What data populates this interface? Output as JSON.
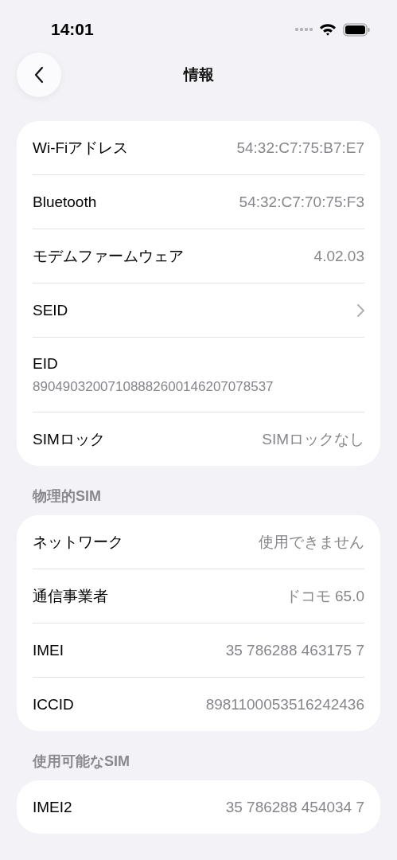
{
  "status_bar": {
    "time": "14:01"
  },
  "nav": {
    "title": "情報"
  },
  "sections": [
    {
      "rows": [
        {
          "kind": "value",
          "label": "Wi-Fiアドレス",
          "value": "54:32:C7:75:B7:E7"
        },
        {
          "kind": "value",
          "label": "Bluetooth",
          "value": "54:32:C7:70:75:F3"
        },
        {
          "kind": "value",
          "label": "モデムファームウェア",
          "value": "4.02.03"
        },
        {
          "kind": "chevron",
          "label": "SEID"
        },
        {
          "kind": "stacked",
          "label": "EID",
          "value": "89049032007108882600146207078537"
        },
        {
          "kind": "value",
          "label": "SIMロック",
          "value": "SIMロックなし"
        }
      ]
    },
    {
      "header": "物理的SIM",
      "rows": [
        {
          "kind": "value",
          "label": "ネットワーク",
          "value": "使用できません"
        },
        {
          "kind": "value",
          "label": "通信事業者",
          "value": "ドコモ 65.0"
        },
        {
          "kind": "value",
          "label": "IMEI",
          "value": "35 786288 463175 7"
        },
        {
          "kind": "value",
          "label": "ICCID",
          "value": "8981100053516242436"
        }
      ]
    },
    {
      "header": "使用可能なSIM",
      "rows": [
        {
          "kind": "value",
          "label": "IMEI2",
          "value": "35 786288 454034 7"
        }
      ]
    }
  ]
}
